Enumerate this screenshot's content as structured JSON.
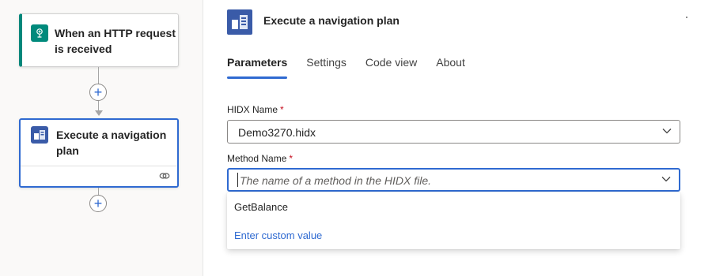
{
  "designer": {
    "trigger": {
      "title": "When an HTTP request is received",
      "icon": "http-request-icon",
      "accent": "#00877b"
    },
    "action": {
      "title": "Execute a navigation plan",
      "icon": "navigation-plan-icon",
      "footer_icon": "link-icon"
    },
    "add_step_icon": "plus-icon"
  },
  "panel": {
    "title": "Execute a navigation plan",
    "tabs": [
      {
        "label": "Parameters",
        "active": true
      },
      {
        "label": "Settings",
        "active": false
      },
      {
        "label": "Code view",
        "active": false
      },
      {
        "label": "About",
        "active": false
      }
    ],
    "hidx": {
      "label": "HIDX Name",
      "required_mark": "*",
      "value": "Demo3270.hidx"
    },
    "method": {
      "label": "Method Name",
      "required_mark": "*",
      "placeholder": "The name of a method in the HIDX file.",
      "options": [
        "GetBalance"
      ],
      "custom_option": "Enter custom value"
    }
  },
  "colors": {
    "accent": "#2f6ad1",
    "required": "#c50f1f",
    "icon_bg": "#3a5ba8"
  }
}
